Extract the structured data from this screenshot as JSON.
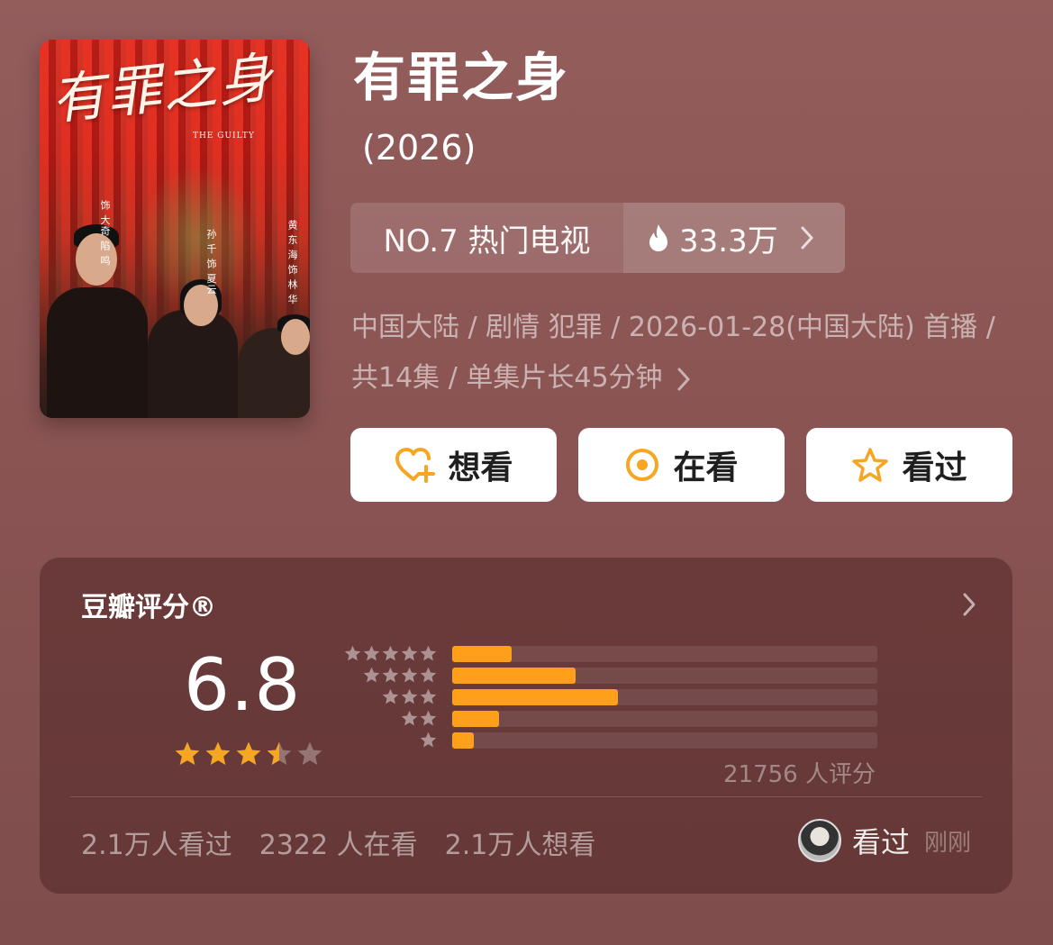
{
  "poster": {
    "title_art": "有罪之身",
    "subtitle_art": "THE GUILTY",
    "cast_a": "饰 大奇 陷 鸣",
    "cast_b": "孙 千 饰 夏云",
    "cast_c": "黄 东 海 饰 林 华"
  },
  "header": {
    "title": "有罪之身",
    "year": "(2026)"
  },
  "rank": {
    "label": "NO.7 热门电视",
    "heat": "33.3万",
    "flame_icon": "flame-icon",
    "chevron_icon": "chevron-right-icon"
  },
  "meta": {
    "text": "中国大陆 / 剧情 犯罪 / 2026-01-28(中国大陆) 首播 / 共14集 / 单集片长45分钟"
  },
  "actions": {
    "want_label": "想看",
    "doing_label": "在看",
    "done_label": "看过",
    "accent": "#f5a623"
  },
  "rating": {
    "title": "豆瓣评分®",
    "score": "6.8",
    "stars_value": 3.5,
    "stars_max": 5,
    "distribution": [
      {
        "stars": 5,
        "fraction": 0.14
      },
      {
        "stars": 4,
        "fraction": 0.29
      },
      {
        "stars": 3,
        "fraction": 0.39
      },
      {
        "stars": 2,
        "fraction": 0.11
      },
      {
        "stars": 1,
        "fraction": 0.05
      }
    ],
    "raters": "21756 人评分",
    "bar_color": "#ff9f1a"
  },
  "stats": {
    "watched": "2.1万人看过",
    "watching": "2322 人在看",
    "wish": "2.1万人想看"
  },
  "me": {
    "status": "看过",
    "time": "刚刚"
  }
}
